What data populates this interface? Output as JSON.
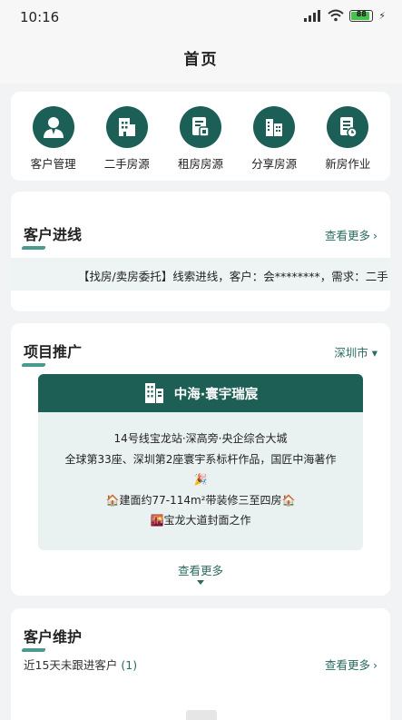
{
  "status": {
    "time": "10:16",
    "network": "HD",
    "battery": "88",
    "battery_level": 0.88
  },
  "nav": {
    "title": "首页"
  },
  "quick": [
    {
      "label": "客户管理",
      "icon": "user-icon"
    },
    {
      "label": "二手房源",
      "icon": "building-icon"
    },
    {
      "label": "租房房源",
      "icon": "rent-doc-icon"
    },
    {
      "label": "分享房源",
      "icon": "share-building-icon"
    },
    {
      "label": "新房作业",
      "icon": "task-doc-icon"
    }
  ],
  "leads": {
    "title": "客户进线",
    "more": "查看更多",
    "ticker": "【找房/卖房委托】线索进线，客户：会********，需求：二手"
  },
  "project": {
    "title": "项目推广",
    "city": "深圳市",
    "name": "中海·寰宇瑞宸",
    "lines": [
      "14号线宝龙站·深高旁·央企综合大城",
      "全球第33座、深圳第2座寰宇系标杆作品，国匠中海著作",
      "🎉",
      "🏠建面约77-114m²带装修三至四房🏠",
      "🌇宝龙大道封面之作"
    ],
    "more": "查看更多"
  },
  "maintenance": {
    "title": "客户维护",
    "subtitle": "近15天未跟进客户",
    "count": "(1)",
    "more": "查看更多"
  },
  "colors": {
    "brand": "#1d5e55",
    "accent": "#2a6b60",
    "background": "#f2f3f5"
  }
}
